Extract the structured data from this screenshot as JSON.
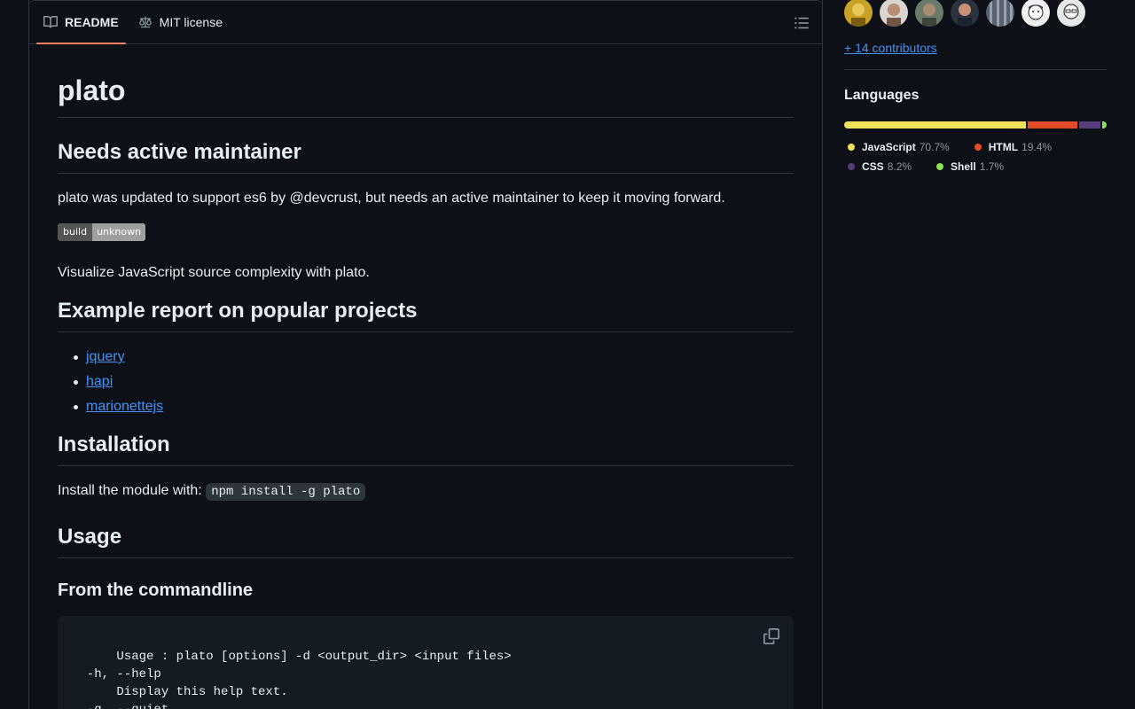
{
  "readme": {
    "tabs": [
      {
        "label": "README",
        "icon": "book-icon",
        "active": true
      },
      {
        "label": "MIT license",
        "icon": "law-icon",
        "active": false
      }
    ],
    "title": "plato",
    "sections": {
      "maintainer_heading": "Needs active maintainer",
      "maintainer_text": "plato was updated to support es6 by @devcrust, but needs an active maintainer to keep it moving forward.",
      "badge_left": "build",
      "badge_right": "unknown",
      "intro_text": "Visualize JavaScript source complexity with plato.",
      "example_heading": "Example report on popular projects",
      "example_links": [
        "jquery",
        "hapi",
        "marionettejs"
      ],
      "install_heading": "Installation",
      "install_text": "Install the module with: ",
      "install_code": "npm install -g plato",
      "usage_heading": "Usage",
      "cmdline_heading": "From the commandline",
      "code_block": "Usage : plato [options] -d <output_dir> <input files>\n  -h, --help\n      Display this help text.\n  -q, --quiet"
    }
  },
  "sidebar": {
    "contributors_link": "+ 14 contributors",
    "languages_title": "Languages",
    "languages": [
      {
        "name": "JavaScript",
        "percent": "70.7%",
        "value": 70.7,
        "color": "#f1e05a"
      },
      {
        "name": "HTML",
        "percent": "19.4%",
        "value": 19.4,
        "color": "#e34c26"
      },
      {
        "name": "CSS",
        "percent": "8.2%",
        "value": 8.2,
        "color": "#563d7c"
      },
      {
        "name": "Shell",
        "percent": "1.7%",
        "value": 1.7,
        "color": "#89e051"
      }
    ]
  },
  "colors": {
    "accent_tab": "#f78166",
    "link": "#4493f8",
    "background": "#0d1117"
  }
}
